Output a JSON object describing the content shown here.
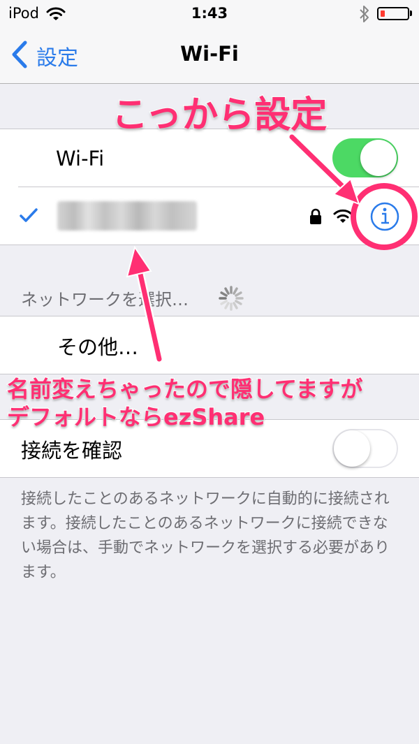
{
  "status_bar": {
    "carrier": "iPod",
    "time": "1:43",
    "battery_level": 0.15
  },
  "nav": {
    "back_label": "設定",
    "title": "Wi-Fi"
  },
  "wifi_section": {
    "wifi_label": "Wi-Fi",
    "wifi_enabled": true,
    "connected_network_name_blurred": true
  },
  "network_section": {
    "header": "ネットワークを選択…",
    "other_label": "その他…"
  },
  "ask_section": {
    "ask_to_join_label": "接続を確認",
    "ask_to_join_enabled": false,
    "footer": "接続したことのあるネットワークに自動的に接続されます。接続したことのあるネットワークに接続できない場合は、手動でネットワークを選択する必要があります。"
  },
  "annotations": {
    "top_text": "こっから設定",
    "bottom_line1": "名前変えちゃったので隠してますが",
    "bottom_line2": "デフォルトならezShare",
    "color": "#ff2f73"
  },
  "colors": {
    "accent": "#2a7bea",
    "toggle_on": "#4cd964",
    "background": "#efeff4"
  }
}
